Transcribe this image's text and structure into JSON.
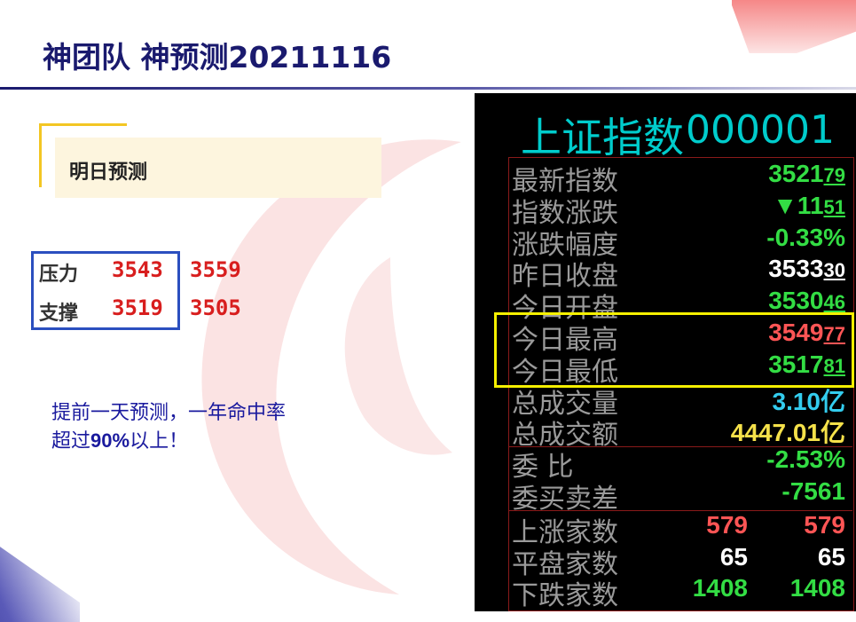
{
  "title": "神团队 神预测20211116",
  "section_title": "明日预测",
  "levels": {
    "resistance_label": "压力",
    "resistance_1": "3543",
    "resistance_2": "3559",
    "support_label": "支撑",
    "support_1": "3519",
    "support_2": "3505"
  },
  "note": {
    "line1": "提前一天预测，一年命中率",
    "line2_prefix": "超过",
    "line2_pct": "90%",
    "line2_suffix": "以上！"
  },
  "quote_panel": {
    "name": "上证指数",
    "code": "000001",
    "rows": [
      {
        "label": "最新指数",
        "int": "3521",
        "dec": "79",
        "color": "g"
      },
      {
        "label": "指数涨跌",
        "int": "▼11",
        "dec": "51",
        "color": "g"
      },
      {
        "label": "涨跌幅度",
        "int": "-0.33%",
        "dec": "",
        "color": "g"
      },
      {
        "label": "昨日收盘",
        "int": "3533",
        "dec": "30",
        "color": "w"
      },
      {
        "label": "今日开盘",
        "int": "3530",
        "dec": "46",
        "color": "g"
      },
      {
        "label": "今日最高",
        "int": "3549",
        "dec": "77",
        "color": "r"
      },
      {
        "label": "今日最低",
        "int": "3517",
        "dec": "81",
        "color": "g"
      },
      {
        "label": "总成交量",
        "int": "3.10亿",
        "dec": "",
        "color": "c"
      },
      {
        "label": "总成交额",
        "int": "4447.01亿",
        "dec": "",
        "color": "y"
      },
      {
        "label": "委    比",
        "int": "-2.53%",
        "dec": "",
        "color": "g"
      },
      {
        "label": "委买卖差",
        "int": "-7561",
        "dec": "",
        "color": "g"
      }
    ],
    "breadth": [
      {
        "label": "上涨家数",
        "a": "579",
        "b": "579",
        "color": "r"
      },
      {
        "label": "平盘家数",
        "a": "65",
        "b": "65",
        "color": "w"
      },
      {
        "label": "下跌家数",
        "a": "1408",
        "b": "1408",
        "color": "g"
      }
    ]
  },
  "colors": {
    "accent_navy": "#1a1a6e",
    "resistance_red": "#d81e1e",
    "frame_blue": "#2b4fbf",
    "highlight_yellow": "#f5f000"
  }
}
